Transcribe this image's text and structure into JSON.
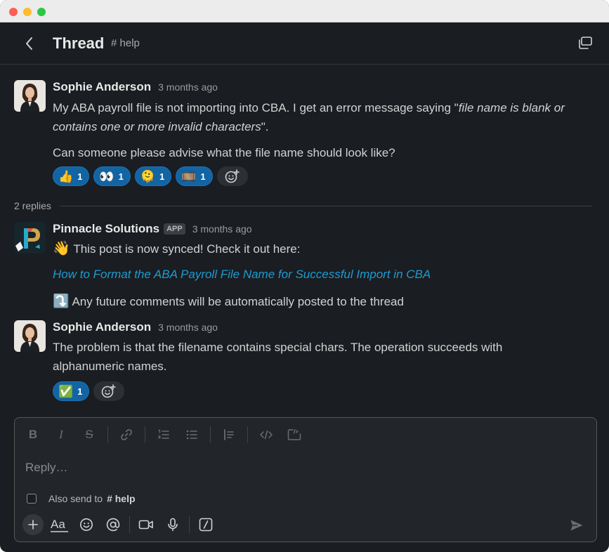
{
  "header": {
    "title": "Thread",
    "channel": "# help"
  },
  "parent_message": {
    "author": "Sophie Anderson",
    "timestamp": "3 months ago",
    "text_before_quote": "My ABA payroll file is not importing into CBA. I get an error message saying \"",
    "quote": "file name is blank or contains one or more invalid characters",
    "text_after_quote": "\".",
    "text_second": "Can someone please advise what the file name should look like?",
    "reactions": [
      {
        "emoji": "👍",
        "count": "1"
      },
      {
        "emoji": "👀",
        "count": "1"
      },
      {
        "emoji": "🫠",
        "count": "1"
      },
      {
        "emoji": "🎞️",
        "count": "1"
      }
    ]
  },
  "replies_label": "2 replies",
  "reply_1": {
    "author": "Pinnacle Solutions",
    "badge": "APP",
    "timestamp": "3 months ago",
    "emoji_line1": "👋",
    "line1": "This post is now synced! Check it out here:",
    "link": "How to Format the ABA Payroll File Name for Successful Import in CBA",
    "emoji_line2": "⤵️",
    "line2": "Any future comments will be automatically posted to the thread"
  },
  "reply_2": {
    "author": "Sophie Anderson",
    "timestamp": "3 months ago",
    "text": "The problem is that the filename contains special chars. The operation succeeds with alphanumeric names.",
    "reactions": [
      {
        "emoji": "✅",
        "count": "1"
      }
    ]
  },
  "composer": {
    "placeholder": "Reply…",
    "also_send_label": "Also send to",
    "also_send_channel": "# help"
  },
  "colors": {
    "background": "#1a1d21",
    "link": "#1d9bd1",
    "reaction_bg": "#1264a3"
  }
}
